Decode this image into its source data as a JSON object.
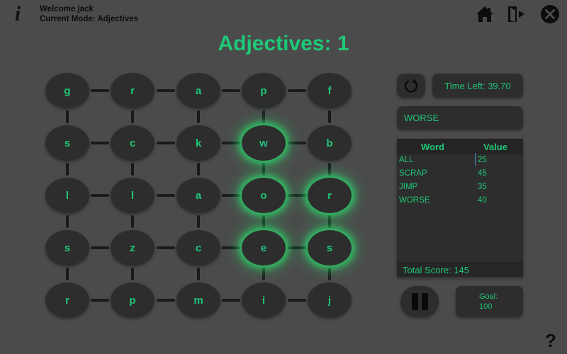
{
  "header": {
    "welcome": "Welcome jack",
    "mode": "Current Mode: Adjectives",
    "icons": [
      "info-icon",
      "home-icon",
      "exit-icon",
      "close-icon"
    ]
  },
  "title": "Adjectives: 1",
  "grid": {
    "rows": [
      [
        "g",
        "r",
        "a",
        "p",
        "f"
      ],
      [
        "s",
        "c",
        "k",
        "w",
        "b"
      ],
      [
        "l",
        "l",
        "a",
        "o",
        "r"
      ],
      [
        "s",
        "z",
        "c",
        "e",
        "s"
      ],
      [
        "r",
        "p",
        "m",
        "i",
        "j"
      ]
    ],
    "selected_path": [
      [
        1,
        3
      ],
      [
        2,
        3
      ],
      [
        2,
        4
      ],
      [
        3,
        4
      ],
      [
        3,
        3
      ]
    ]
  },
  "timer": {
    "label": "Time Left: 39.70"
  },
  "current_word": "WORSE",
  "scores": {
    "headers": {
      "word": "Word",
      "value": "Value"
    },
    "rows": [
      {
        "word": "ALL",
        "value": "25"
      },
      {
        "word": "SCRAP",
        "value": "45"
      },
      {
        "word": "JIMP",
        "value": "35"
      },
      {
        "word": "WORSE",
        "value": "40"
      }
    ],
    "total": "Total Score: 145"
  },
  "goal": {
    "label": "Goal:",
    "value": "100"
  },
  "help": "?",
  "colors": {
    "accent": "#1fc678",
    "tile": "#2d2d2d",
    "background": "#4b4b4b",
    "glow": "#28e66e"
  }
}
